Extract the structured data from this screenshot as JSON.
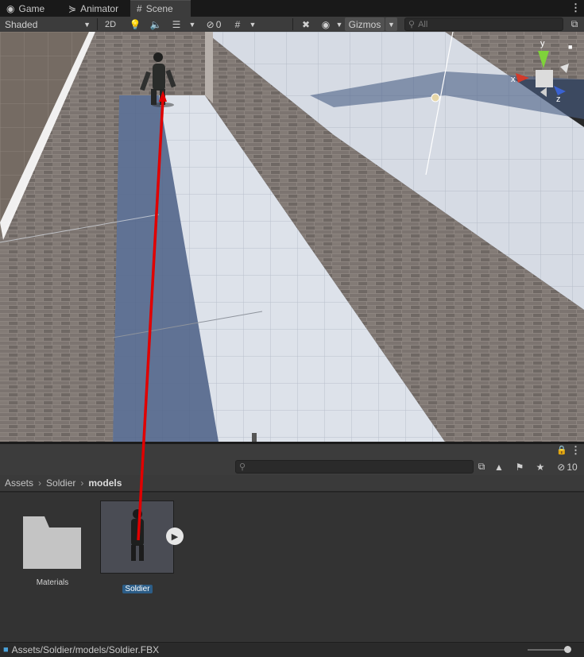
{
  "tabs": [
    {
      "label": "Game",
      "icon": "gamepad-icon"
    },
    {
      "label": "Animator",
      "icon": "animator-icon"
    },
    {
      "label": "Scene",
      "icon": "hash-icon"
    }
  ],
  "scene_toolbar": {
    "shading_mode": "Shaded",
    "mode_2d": "2D",
    "hidden_count": "0",
    "gizmos": "Gizmos",
    "search_placeholder": "All"
  },
  "gizmo": {
    "axis_x": "x",
    "axis_y": "y",
    "axis_z": "z"
  },
  "project": {
    "hidden_count": "10",
    "breadcrumb": [
      "Assets",
      "Soldier",
      "models"
    ],
    "assets": [
      {
        "name": "Materials",
        "type": "folder"
      },
      {
        "name": "Soldier",
        "type": "model",
        "selected": true
      }
    ]
  },
  "status": {
    "path": "Assets/Soldier/models/Soldier.FBX"
  },
  "colors": {
    "accent": "#2c5d87",
    "drag_arrow": "#e00000",
    "gizmo_x": "#d23a2a",
    "gizmo_y": "#7fd23a",
    "gizmo_z": "#3a62d2"
  }
}
